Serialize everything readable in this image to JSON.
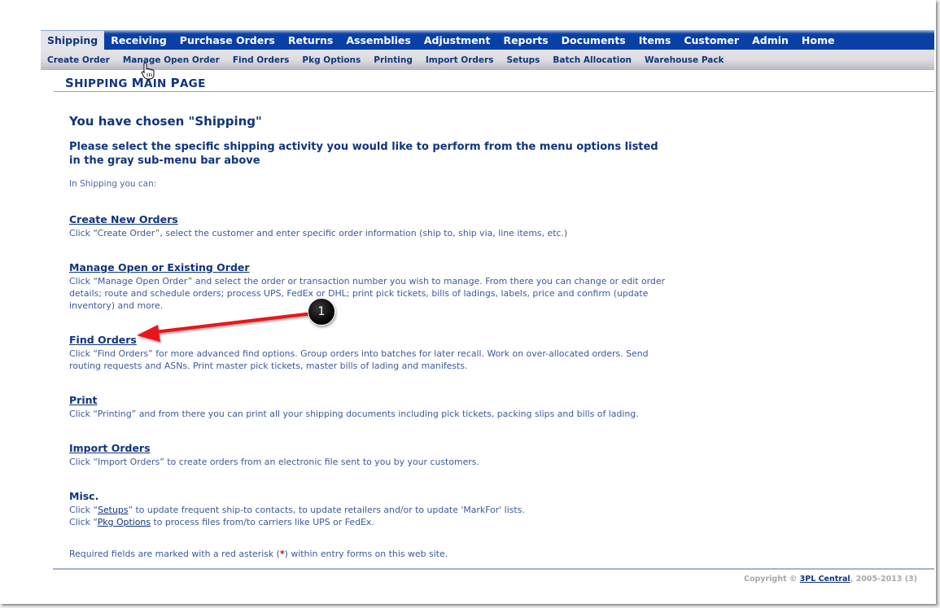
{
  "nav": {
    "tabs": [
      {
        "label": "Shipping",
        "active": true
      },
      {
        "label": "Receiving"
      },
      {
        "label": "Purchase Orders"
      },
      {
        "label": "Returns"
      },
      {
        "label": "Assemblies"
      },
      {
        "label": "Adjustment"
      },
      {
        "label": "Reports"
      },
      {
        "label": "Documents"
      },
      {
        "label": "Items"
      },
      {
        "label": "Customer"
      },
      {
        "label": "Admin"
      },
      {
        "label": "Home"
      }
    ],
    "subtabs": [
      {
        "label": "Create Order"
      },
      {
        "label": "Manage Open Order"
      },
      {
        "label": "Find Orders"
      },
      {
        "label": "Pkg Options"
      },
      {
        "label": "Printing"
      },
      {
        "label": "Import Orders"
      },
      {
        "label": "Setups"
      },
      {
        "label": "Batch Allocation"
      },
      {
        "label": "Warehouse Pack"
      }
    ]
  },
  "page": {
    "title_parts": [
      "S",
      "HIPPING ",
      "M",
      "AIN ",
      "P",
      "AGE"
    ],
    "chosen": "You have chosen \"Shipping\"",
    "instruction": "Please select the specific shipping activity you would like to perform from the menu options listed in the gray sub-menu bar above",
    "intro": "In Shipping you can:"
  },
  "sections": [
    {
      "title": "Create New Orders",
      "desc": "Click “Create Order”, select the customer and enter specific order information (ship to, ship via, line items, etc.)"
    },
    {
      "title": "Manage Open or Existing Order",
      "desc": "Click “Manage Open Order” and select the order or transaction number you wish to manage. From there you can change or edit order details; route and schedule orders; process UPS, FedEx or DHL; print pick tickets, bills of ladings, labels, price and confirm (update inventory) and more."
    },
    {
      "title": "Find Orders",
      "desc": "Click “Find Orders” for more advanced find options. Group orders into batches for later recall. Work on over-allocated orders. Send routing requests and ASNs. Print master pick tickets, master bills of lading and manifests."
    },
    {
      "title": "Print",
      "desc": "Click “Printing” and from there you can print all your shipping documents including pick tickets, packing slips and bills of lading."
    },
    {
      "title": "Import Orders",
      "desc": "Click “Import Orders” to create orders from an electronic file sent to you by your customers."
    }
  ],
  "misc": {
    "title": "Misc.",
    "line1_prefix": "Click “",
    "line1_link": "Setups",
    "line1_suffix": "” to update frequent ship-to contacts, to update retailers and/or to update 'MarkFor' lists.",
    "line2_prefix": "Click “",
    "line2_link": "Pkg Options",
    "line2_suffix": " to process files from/to carriers like UPS or FedEx."
  },
  "required": {
    "prefix": "Required fields are marked with a red asterisk (",
    "asterisk": "*",
    "suffix": ") within entry forms on this web site."
  },
  "footer": {
    "prefix": "Copyright © ",
    "link": "3PL Central",
    "suffix": ", 2005-2013 (3)"
  },
  "annotation": {
    "badge_number": "1",
    "color": "#e8141a"
  },
  "icons": {
    "cursor": "hand-pointer-icon"
  }
}
